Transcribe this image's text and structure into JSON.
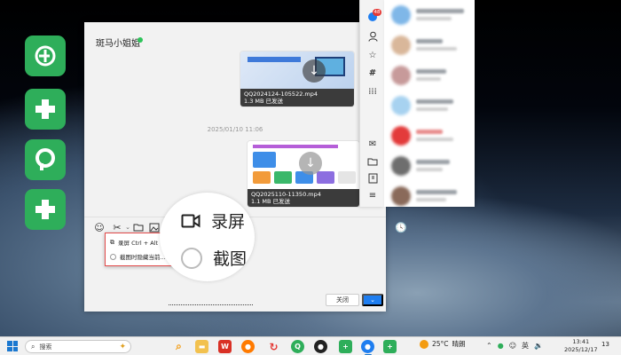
{
  "desktop": {
    "icons": [
      {
        "name": "app-icon-1",
        "color": "#2eae5a"
      },
      {
        "name": "app-icon-2",
        "color": "#2eae5a"
      },
      {
        "name": "app-icon-3",
        "color": "#2eae5a"
      },
      {
        "name": "app-icon-4",
        "color": "#2eae5a"
      }
    ]
  },
  "chat": {
    "title": "斑马小姐姐",
    "messages": [
      {
        "file_name": "QQ2024124-105522.mp4",
        "file_info": "1.3 MB 已发送"
      },
      {
        "file_name": "QQ2025110-11350.mp4",
        "file_info": "1.1 MB 已发送"
      }
    ],
    "time_separator": "2025/01/10 11:06",
    "dropdown": {
      "record_label": "录屏 Ctrl + Alt",
      "hide_label": "截图时隐藏当前..."
    },
    "magnifier": {
      "record_text": "录屏",
      "screenshot_text": "截图"
    },
    "buttons": {
      "close": "关闭",
      "send_arrow": "⌄"
    },
    "accent_color": "#1f7ef0"
  },
  "rail": {
    "badge": "48"
  },
  "taskbar": {
    "search_placeholder": "搜索",
    "weather_temp": "25°C",
    "weather_desc": "晴朗",
    "ime_label": "英",
    "time": "13:41",
    "date": "2025/12/17",
    "notification_count": "13"
  }
}
